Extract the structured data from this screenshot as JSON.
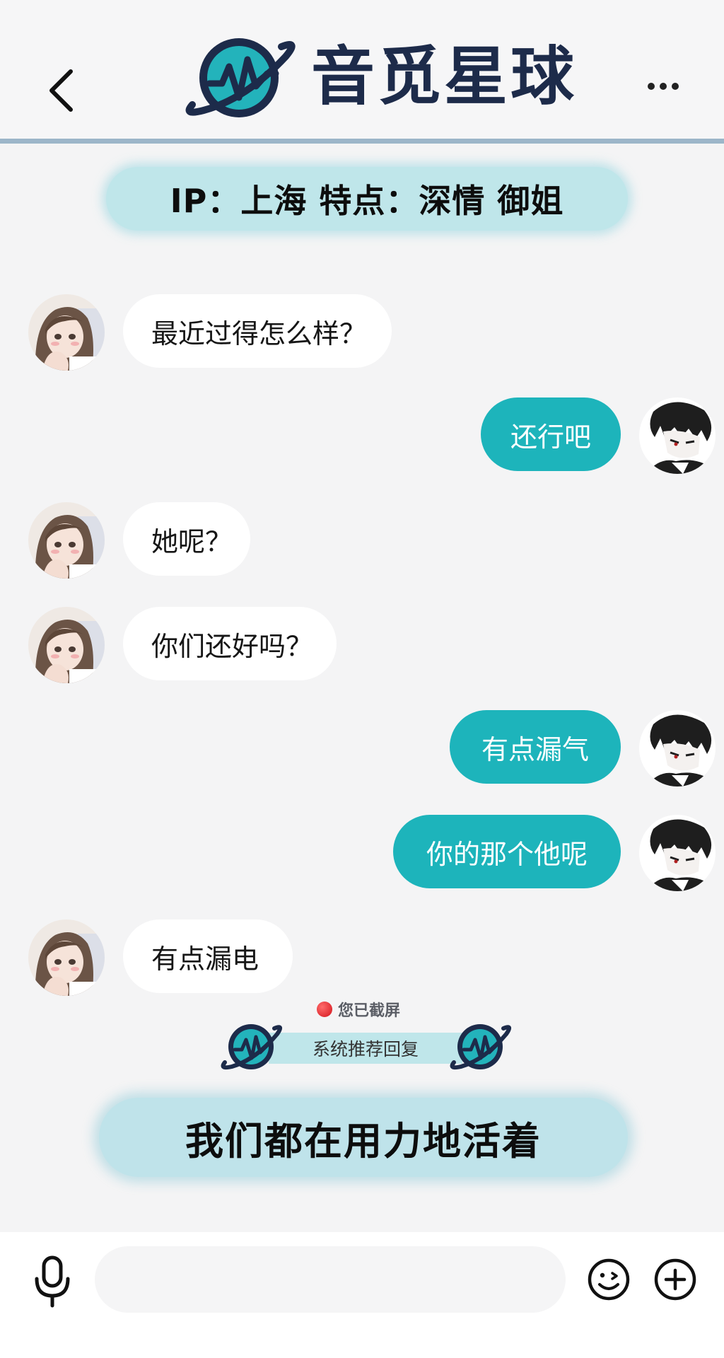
{
  "header": {
    "title": "音觅星球"
  },
  "profile_info": {
    "text": "IP：上海 特点：深情 御姐"
  },
  "messages": [
    {
      "side": "in",
      "text": "最近过得怎么样？"
    },
    {
      "side": "out",
      "text": "还行吧"
    },
    {
      "side": "in",
      "text": "她呢？"
    },
    {
      "side": "in",
      "text": "你们还好吗？"
    },
    {
      "side": "out",
      "text": "有点漏气"
    },
    {
      "side": "out",
      "text": "你的那个他呢"
    },
    {
      "side": "in",
      "text": "有点漏电"
    }
  ],
  "screenshot_notice": "您已截屏",
  "recommendation": {
    "label": "系统推荐回复",
    "reply": "我们都在用力地活着"
  },
  "input_bar": {
    "message_value": "",
    "placeholder": ""
  },
  "colors": {
    "accent": "#1db4bb",
    "pill": "#bfe6ea",
    "logo_text": "#1d2b4a"
  },
  "icons": [
    "back-arrow-icon",
    "planet-logo-icon",
    "more-dots-icon",
    "microphone-icon",
    "emoji-icon",
    "plus-icon"
  ]
}
